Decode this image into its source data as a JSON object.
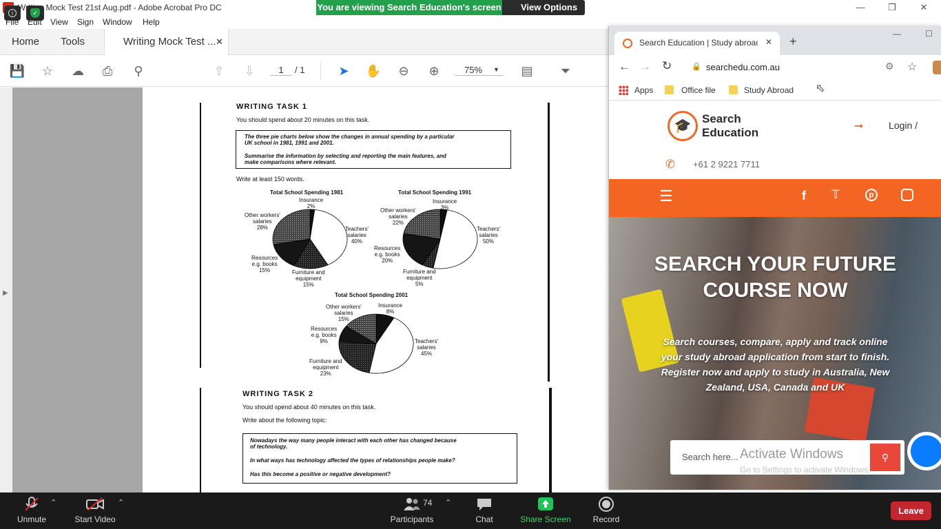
{
  "acrobat": {
    "title": "Writing Mock Test 21st Aug.pdf - Adobe Acrobat Pro DC",
    "menu": [
      "File",
      "Edit",
      "View",
      "Sign",
      "Window",
      "Help"
    ],
    "tabs": {
      "home": "Home",
      "tools": "Tools",
      "document": "Writing Mock Test ..."
    },
    "page_current": "1",
    "page_total": "/ 1",
    "zoom": "75%"
  },
  "pdf": {
    "task1_heading": "WRITING TASK 1",
    "task1_time": "You should spend about 20 minutes on this task.",
    "task1_prompt_1": "The three pie charts below show the changes in annual spending by a particular",
    "task1_prompt_2": "UK school in 1981, 1991 and 2001.",
    "task1_prompt_3": "Summarise the information by selecting and reporting the main features, and",
    "task1_prompt_4": "make comparisons where relevant.",
    "task1_words": "Write at least 150 words.",
    "charts": [
      {
        "title": "Total School Spending 1981",
        "slices": [
          {
            "label": "Insurance",
            "value": 2
          },
          {
            "label": "Teachers' salaries",
            "value": 40
          },
          {
            "label": "Furniture and equipment",
            "value": 15
          },
          {
            "label": "Resources e.g. books",
            "value": 15
          },
          {
            "label": "Other workers' salaries",
            "value": 28
          }
        ]
      },
      {
        "title": "Total School Spending 1991",
        "slices": [
          {
            "label": "Insurance",
            "value": 3
          },
          {
            "label": "Teachers' salaries",
            "value": 50
          },
          {
            "label": "Furniture and equipment",
            "value": 5
          },
          {
            "label": "Resources e.g. books",
            "value": 20
          },
          {
            "label": "Other workers' salaries",
            "value": 22
          }
        ]
      },
      {
        "title": "Total School Spending 2001",
        "slices": [
          {
            "label": "Insurance",
            "value": 8
          },
          {
            "label": "Teachers' salaries",
            "value": 45
          },
          {
            "label": "Furniture and equipment",
            "value": 23
          },
          {
            "label": "Resources e.g. books",
            "value": 9
          },
          {
            "label": "Other workers' salaries",
            "value": 15
          }
        ]
      }
    ],
    "labels": {
      "insurance": "Insurance",
      "teachers_1": "Teachers'",
      "teachers_2": "salaries",
      "other_1": "Other workers'",
      "other_2": "salaries",
      "resources_1": "Resources",
      "resources_2": "e.g. books",
      "furniture_1": "Furniture and",
      "furniture_2": "equipment",
      "c1_ins": "2%",
      "c1_teach": "40%",
      "c1_furn": "15%",
      "c1_res": "15%",
      "c1_other": "28%",
      "c2_ins": "3%",
      "c2_teach": "50%",
      "c2_furn": "5%",
      "c2_res": "20%",
      "c2_other": "22%",
      "c3_ins": "8%",
      "c3_teach": "45%",
      "c3_furn": "23%",
      "c3_res": "9%",
      "c3_other": "15%"
    },
    "task2_heading": "WRITING TASK 2",
    "task2_time": "You should spend about 40 minutes on this task.",
    "task2_topic": "Write about the following topic:",
    "task2_prompt_1": "Nowadays the way many people interact with each other has changed because",
    "task2_prompt_2": "of technology.",
    "task2_prompt_3": "In what ways has technology affected the types of relationships people make?",
    "task2_prompt_4": "Has this become a positive or negative development?"
  },
  "zoom_banner": {
    "message": "You are viewing Search Education's screen",
    "options": "View Options"
  },
  "browser": {
    "tab_title": "Search Education | Study abroad",
    "url": "searchedu.com.au",
    "bookmarks": [
      "Apps",
      "Office file",
      "Study Abroad"
    ],
    "site": {
      "logo_line1": "Search",
      "logo_line2": "Education",
      "login": "Login /",
      "phone": "+61 2 9221 7711",
      "hero_title_1": "SEARCH YOUR FUTURE",
      "hero_title_2": "COURSE NOW",
      "hero_sub_1": "Search courses, compare, apply and track online",
      "hero_sub_2": "your study abroad application from start to finish.",
      "hero_sub_3": "Register now and apply to study in Australia, New",
      "hero_sub_4": "Zealand, USA, Canada and UK",
      "search_placeholder": "Search here...",
      "watermark_1": "Activate Windows",
      "watermark_2": "Go to Settings to activate Windows."
    },
    "accent": "#f26522"
  },
  "zoom_bar": {
    "unmute": "Unmute",
    "start_video": "Start Video",
    "participants": "Participants",
    "participant_count": "74",
    "chat": "Chat",
    "share_screen": "Share Screen",
    "record": "Record",
    "leave": "Leave"
  }
}
